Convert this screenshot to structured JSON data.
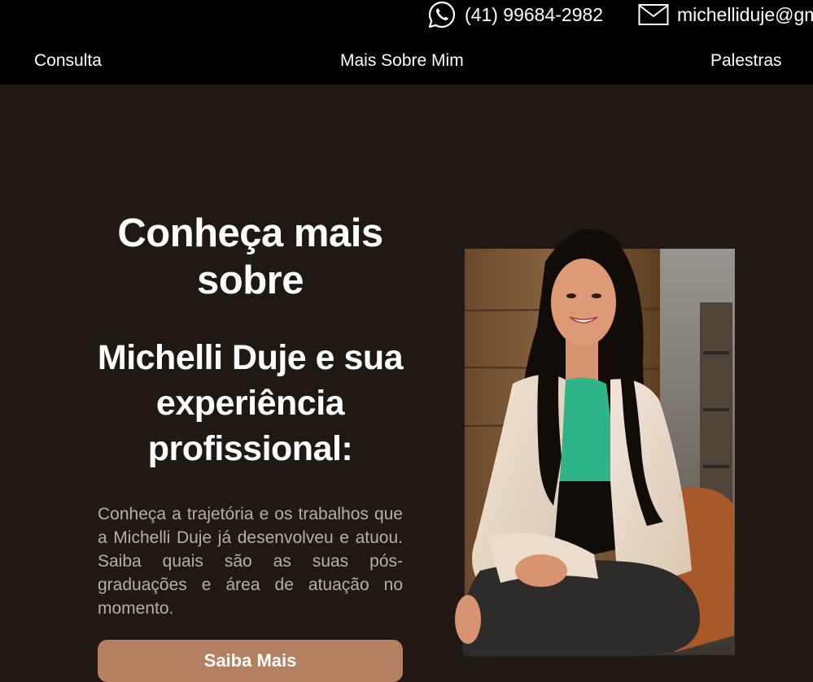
{
  "header": {
    "phone": {
      "icon": "whatsapp-icon",
      "text": "(41) 99684-2982"
    },
    "email": {
      "icon": "envelope-icon",
      "text": "michelliduje@gm"
    },
    "nav": [
      {
        "label": "Consulta"
      },
      {
        "label": "Mais Sobre Mim"
      },
      {
        "label": "Palestras"
      }
    ]
  },
  "hero": {
    "title_line1": "Conheça mais sobre",
    "title_line2": "Michelli Duje e sua experiência profissional:",
    "description": "Conheça a trajetória e os trabalhos que a Michelli Duje já desenvolveu e atuou. Saiba quais são as suas pós-graduações e área de atuação no momento.",
    "button_label": "Saiba Mais",
    "photo": "portrait-photo"
  },
  "colors": {
    "header_bg": "#000000",
    "page_bg": "#201913",
    "button_bg": "#b57f61",
    "body_text": "#b7aea4"
  }
}
